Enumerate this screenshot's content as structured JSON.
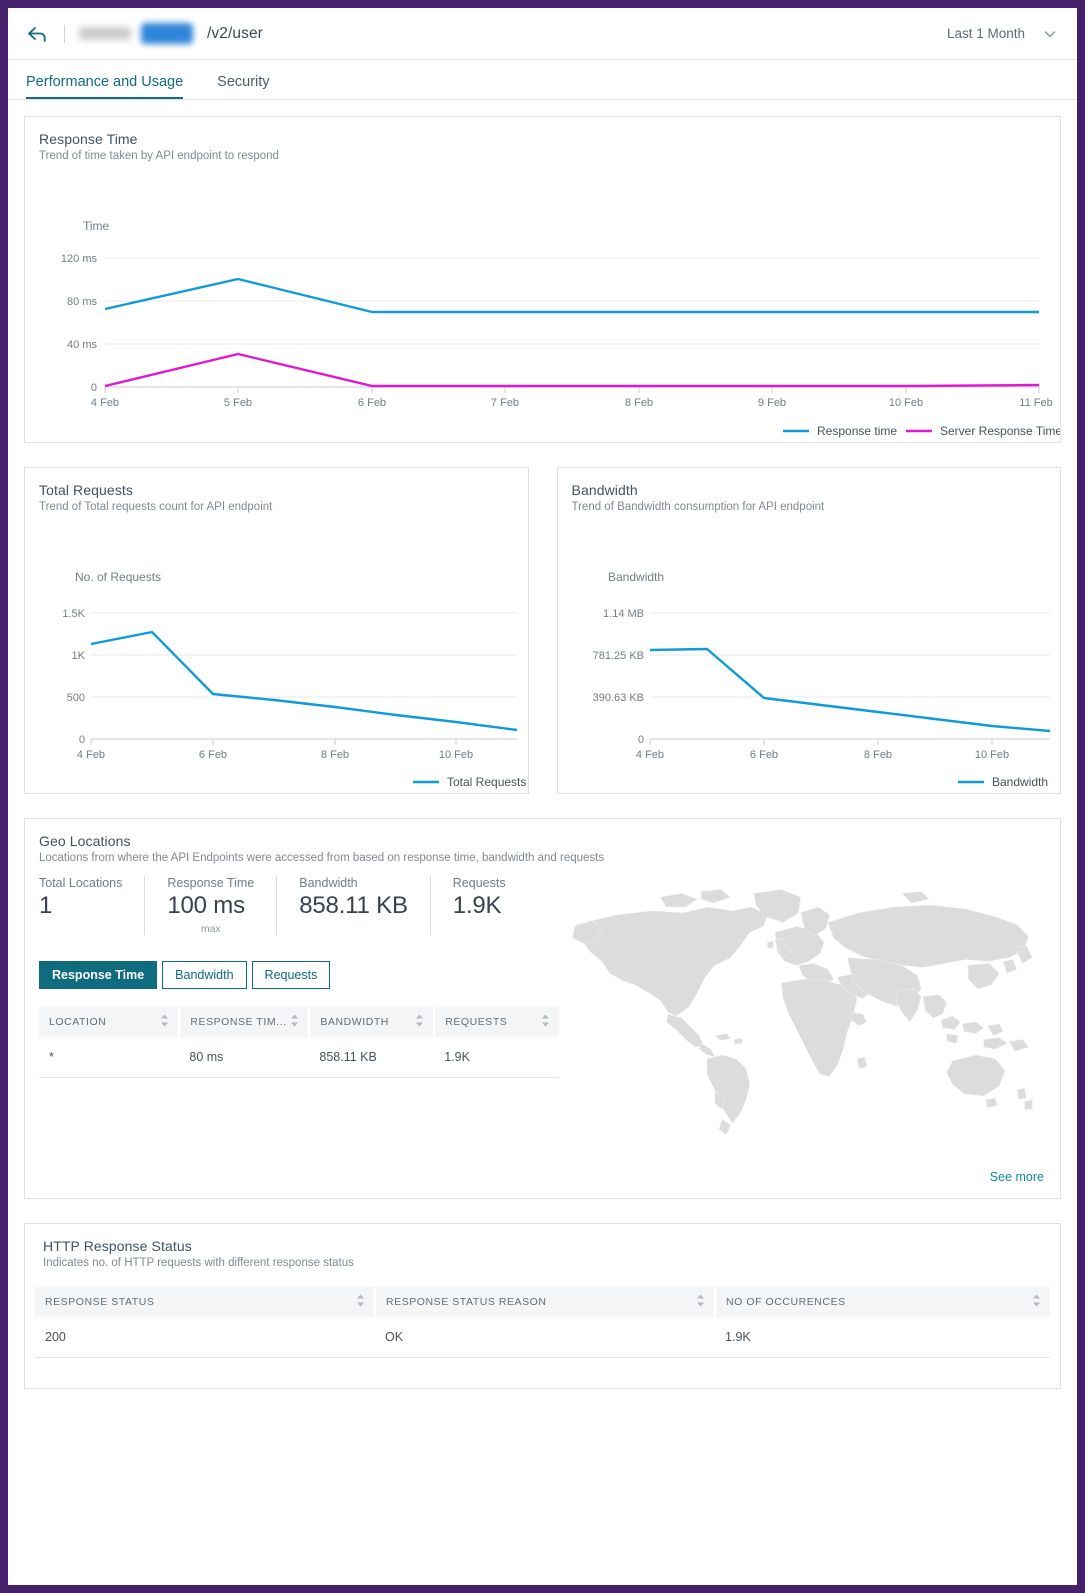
{
  "theme": {
    "frame": "#46216a",
    "accent_teal": "#0f6b7e",
    "link_teal": "#0f8aa3",
    "series_blue": "#0f9bd7",
    "series_magenta": "#e018d0",
    "map_gray": "#dcdcdc"
  },
  "header": {
    "back_icon": "back-arrow-icon",
    "redacted_name": "",
    "redacted_badge": "",
    "endpoint_path": "/v2/user",
    "time_range": "Last 1 Month",
    "chevron_icon": "chevron-down-icon"
  },
  "tabs": [
    {
      "label": "Performance and Usage",
      "active": true
    },
    {
      "label": "Security",
      "active": false
    }
  ],
  "response_time_card": {
    "title": "Response Time",
    "subtitle": "Trend of time taken by API endpoint to respond"
  },
  "total_requests_card": {
    "title": "Total Requests",
    "subtitle": "Trend of Total requests count for API endpoint"
  },
  "bandwidth_card": {
    "title": "Bandwidth",
    "subtitle": "Trend of Bandwidth consumption for API endpoint"
  },
  "geo": {
    "title": "Geo Locations",
    "subtitle": "Locations from where the API Endpoints were accessed from based on response time, bandwidth and requests",
    "stats": [
      {
        "label": "Total Locations",
        "value": "1",
        "note": ""
      },
      {
        "label": "Response Time",
        "value": "100 ms",
        "note": "max"
      },
      {
        "label": "Bandwidth",
        "value": "858.11 KB",
        "note": ""
      },
      {
        "label": "Requests",
        "value": "1.9K",
        "note": ""
      }
    ],
    "segments": [
      {
        "label": "Response Time",
        "active": true
      },
      {
        "label": "Bandwidth",
        "active": false
      },
      {
        "label": "Requests",
        "active": false
      }
    ],
    "table": {
      "columns": [
        "LOCATION",
        "RESPONSE TIM...",
        "BANDWIDTH",
        "REQUESTS"
      ],
      "rows": [
        [
          "*",
          "80 ms",
          "858.11 KB",
          "1.9K"
        ]
      ]
    },
    "see_more": "See more",
    "map_icon": "world-map"
  },
  "http_status": {
    "title": "HTTP Response Status",
    "subtitle": "Indicates no. of HTTP requests with different response status",
    "table": {
      "columns": [
        "RESPONSE STATUS",
        "RESPONSE STATUS REASON",
        "NO OF OCCURENCES"
      ],
      "rows": [
        [
          "200",
          "OK",
          "1.9K"
        ]
      ]
    }
  },
  "chart_data": [
    {
      "type": "line",
      "id": "response-time",
      "title": "Response Time",
      "subtitle": "Trend of time taken by API endpoint to respond",
      "ylabel": "Time",
      "xlabel": "",
      "x": [
        "4 Feb",
        "5 Feb",
        "6 Feb",
        "7 Feb",
        "8 Feb",
        "9 Feb",
        "10 Feb",
        "11 Feb"
      ],
      "yticks": [
        "0",
        "40 ms",
        "80 ms",
        "120 ms"
      ],
      "ytick_values": [
        0,
        40,
        80,
        120
      ],
      "ylim": [
        0,
        130
      ],
      "grid": true,
      "legend_position": "bottom-right",
      "series": [
        {
          "name": "Response time",
          "color": "#0f9bd7",
          "values": [
            73,
            100,
            70,
            70,
            70,
            70,
            70,
            70
          ]
        },
        {
          "name": "Server Response Time",
          "color": "#e018d0",
          "values": [
            1,
            31,
            1,
            1,
            1,
            1,
            1,
            1
          ]
        }
      ]
    },
    {
      "type": "line",
      "id": "total-requests",
      "title": "Total Requests",
      "subtitle": "Trend of Total requests count for API endpoint",
      "ylabel": "No. of Requests",
      "xlabel": "",
      "x": [
        "4 Feb",
        "5 Feb",
        "6 Feb",
        "7 Feb",
        "8 Feb",
        "9 Feb",
        "10 Feb",
        "11 Feb"
      ],
      "xtick_labels": [
        "4 Feb",
        "6 Feb",
        "8 Feb",
        "10 Feb"
      ],
      "yticks": [
        "0",
        "500",
        "1K",
        "1.5K"
      ],
      "ytick_values": [
        0,
        500,
        1000,
        1500
      ],
      "ylim": [
        0,
        1600
      ],
      "grid": true,
      "legend_position": "bottom-right",
      "series": [
        {
          "name": "Total Requests",
          "color": "#0f9bd7",
          "values": [
            1130,
            1270,
            540,
            460,
            380,
            290,
            200,
            110
          ]
        }
      ]
    },
    {
      "type": "line",
      "id": "bandwidth",
      "title": "Bandwidth",
      "subtitle": "Trend of Bandwidth consumption for API endpoint",
      "ylabel": "Bandwidth",
      "xlabel": "",
      "x": [
        "4 Feb",
        "5 Feb",
        "6 Feb",
        "7 Feb",
        "8 Feb",
        "9 Feb",
        "10 Feb",
        "11 Feb"
      ],
      "xtick_labels": [
        "4 Feb",
        "6 Feb",
        "8 Feb",
        "10 Feb"
      ],
      "yticks": [
        "0",
        "390.63 KB",
        "781.25 KB",
        "1.14 MB"
      ],
      "ytick_values": [
        0,
        390.63,
        781.25,
        1167.36
      ],
      "ylim": [
        0,
        1250
      ],
      "grid": true,
      "legend_position": "bottom-right",
      "series": [
        {
          "name": "Bandwidth",
          "color": "#0f9bd7",
          "values": [
            830,
            845,
            385,
            320,
            250,
            185,
            125,
            75
          ]
        }
      ]
    }
  ]
}
